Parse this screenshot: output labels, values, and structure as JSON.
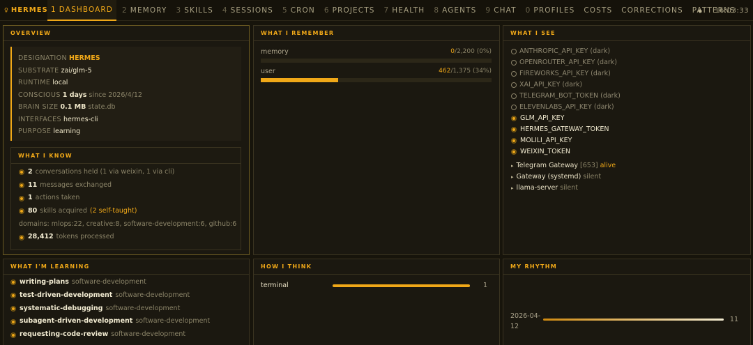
{
  "topbar": {
    "brand": "HERMES",
    "brand_icon": "person-glyph",
    "tabs": [
      {
        "num": "1",
        "label": "DASHBOARD",
        "active": true
      },
      {
        "num": "2",
        "label": "MEMORY"
      },
      {
        "num": "3",
        "label": "SKILLS"
      },
      {
        "num": "4",
        "label": "SESSIONS"
      },
      {
        "num": "5",
        "label": "CRON"
      },
      {
        "num": "6",
        "label": "PROJECTS"
      },
      {
        "num": "7",
        "label": "HEALTH"
      },
      {
        "num": "8",
        "label": "AGENTS"
      },
      {
        "num": "9",
        "label": "CHAT"
      },
      {
        "num": "0",
        "label": "PROFILES"
      },
      {
        "num": "",
        "label": "COSTS"
      },
      {
        "num": "",
        "label": "CORRECTIONS"
      },
      {
        "num": "",
        "label": "PATTERNS"
      }
    ],
    "status_icon": "diamond-icon",
    "clock": "16:03:33"
  },
  "overview": {
    "title": "OVERVIEW",
    "identity": [
      {
        "key": "DESIGNATION",
        "value": "HERMES",
        "suffix": "",
        "highlight": true
      },
      {
        "key": "SUBSTRATE",
        "value": "zai/glm-5",
        "suffix": ""
      },
      {
        "key": "RUNTIME",
        "value": "local",
        "suffix": ""
      },
      {
        "key": "CONSCIOUS",
        "value": "1 days",
        "suffix": "since 2026/4/12"
      },
      {
        "key": "BRAIN SIZE",
        "value": "0.1 MB",
        "suffix": "state.db"
      },
      {
        "key": "INTERFACES",
        "value": "hermes-cli",
        "suffix": ""
      },
      {
        "key": "PURPOSE",
        "value": "learning",
        "suffix": ""
      }
    ],
    "know": {
      "title": "WHAT I KNOW",
      "items": [
        {
          "bold": "2",
          "text": "conversations held (1 via weixin, 1 via cli)",
          "accent": ""
        },
        {
          "bold": "11",
          "text": "messages exchanged",
          "accent": ""
        },
        {
          "bold": "1",
          "text": "actions taken",
          "accent": ""
        },
        {
          "bold": "80",
          "text": "skills acquired",
          "accent": "(2 self-taught)"
        }
      ],
      "domains": "domains: mlops:22, creative:8, software-development:6, github:6",
      "tokens": {
        "bold": "28,412",
        "text": "tokens processed"
      }
    }
  },
  "remember": {
    "title": "WHAT I REMEMBER",
    "rows": [
      {
        "label": "memory",
        "used": "0",
        "total": "/2,200 (0%)",
        "fraction": 0.0
      },
      {
        "label": "user",
        "used": "462",
        "total": "/1,375 (34%)",
        "fraction": 0.336
      }
    ]
  },
  "see": {
    "title": "WHAT I SEE",
    "keys": [
      {
        "name": "ANTHROPIC_API_KEY",
        "note": "(dark)",
        "on": false
      },
      {
        "name": "OPENROUTER_API_KEY",
        "note": "(dark)",
        "on": false
      },
      {
        "name": "FIREWORKS_API_KEY",
        "note": "(dark)",
        "on": false
      },
      {
        "name": "XAI_API_KEY",
        "note": "(dark)",
        "on": false
      },
      {
        "name": "TELEGRAM_BOT_TOKEN",
        "note": "(dark)",
        "on": false
      },
      {
        "name": "ELEVENLABS_API_KEY",
        "note": "(dark)",
        "on": false
      },
      {
        "name": "GLM_API_KEY",
        "note": "",
        "on": true
      },
      {
        "name": "HERMES_GATEWAY_TOKEN",
        "note": "",
        "on": true
      },
      {
        "name": "MOLILI_API_KEY",
        "note": "",
        "on": true
      },
      {
        "name": "WEIXIN_TOKEN",
        "note": "",
        "on": true
      }
    ],
    "services": [
      {
        "name": "Telegram Gateway",
        "pid": "[653]",
        "status": "alive"
      },
      {
        "name": "Gateway (systemd)",
        "pid": "",
        "status": "silent"
      },
      {
        "name": "llama-server",
        "pid": "",
        "status": "silent"
      }
    ]
  },
  "learning": {
    "title": "WHAT I'M LEARNING",
    "items": [
      {
        "skill": "writing-plans",
        "category": "software-development"
      },
      {
        "skill": "test-driven-development",
        "category": "software-development"
      },
      {
        "skill": "systematic-debugging",
        "category": "software-development"
      },
      {
        "skill": "subagent-driven-development",
        "category": "software-development"
      },
      {
        "skill": "requesting-code-review",
        "category": "software-development"
      }
    ]
  },
  "think": {
    "title": "HOW I THINK",
    "rows": [
      {
        "label": "terminal",
        "count": "1",
        "fraction": 1.0
      }
    ]
  },
  "rhythm": {
    "title": "MY RHYTHM",
    "rows": [
      {
        "date": "2026-04-12",
        "count": "11",
        "fraction": 1.0
      }
    ]
  },
  "colors": {
    "accent": "#f0a818",
    "background": "#17140b",
    "muted": "#8b8468"
  }
}
